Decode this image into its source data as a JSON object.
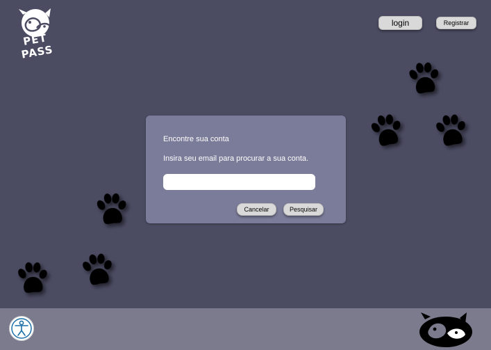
{
  "brand": {
    "name": "PET PASS"
  },
  "header": {
    "login_label": "login",
    "register_label": "Registrar"
  },
  "dialog": {
    "title": "Encontre sua conta",
    "message": "Insira seu email para procurar a sua conta.",
    "email_value": "",
    "cancel_label": "Cancelar",
    "search_label": "Pesquisar"
  },
  "icons": {
    "logo": "cat-dog-logo-icon",
    "paw": "paw-print-icon",
    "accessibility": "accessibility-icon",
    "footer_logo": "cat-dog-logo-icon"
  },
  "colors": {
    "background": "#4b4b62",
    "dialog": "#7b7c99",
    "footer": "#7c7a8d",
    "button": "#d9d9d9",
    "paw": "#000000"
  }
}
